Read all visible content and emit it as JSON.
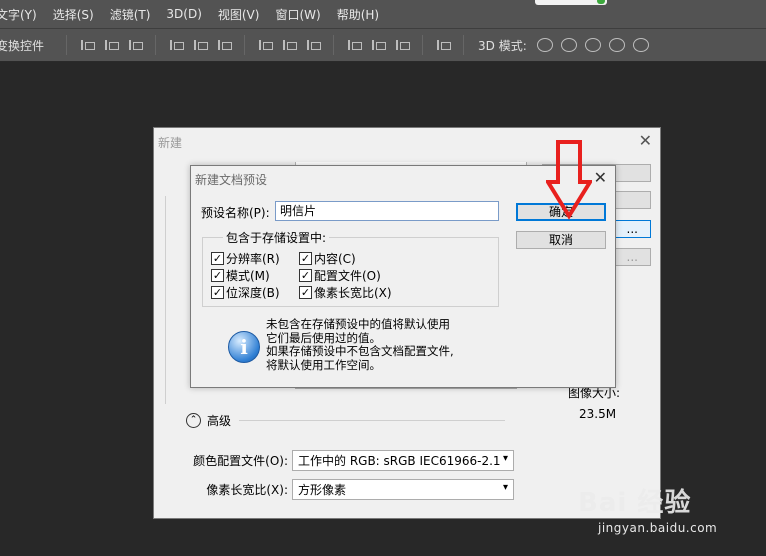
{
  "menubar": {
    "items": [
      "文字(Y)",
      "选择(S)",
      "滤镜(T)",
      "3D(D)",
      "视图(V)",
      "窗口(W)",
      "帮助(H)"
    ]
  },
  "optbar": {
    "transform_label": "变换控件",
    "mode3d_label": "3D 模式:"
  },
  "new_dialog": {
    "title": "新建",
    "close": "✕",
    "image_size_label": "图像大小:",
    "image_size_value": "23.5M",
    "advanced_label": "高级",
    "color_profile_label": "颜色配置文件(O):",
    "color_profile_value": "工作中的 RGB: sRGB IEC61966-2.1",
    "pixel_aspect_label": "像素长宽比(X):",
    "pixel_aspect_value": "方形像素",
    "ellipsis_1": "...",
    "ellipsis_2": "..."
  },
  "preset_dialog": {
    "title": "新建文档预设",
    "close": "✕",
    "name_label": "预设名称(P):",
    "name_value": "明信片",
    "group_legend": "包含于存储设置中:",
    "checkboxes": [
      {
        "label": "分辨率(R)",
        "checked": true
      },
      {
        "label": "内容(C)",
        "checked": true
      },
      {
        "label": "模式(M)",
        "checked": true
      },
      {
        "label": "配置文件(O)",
        "checked": true
      },
      {
        "label": "位深度(B)",
        "checked": true
      },
      {
        "label": "像素长宽比(X)",
        "checked": true
      }
    ],
    "ok_label": "确定",
    "cancel_label": "取消",
    "info_lines": [
      "未包含在存储预设中的值将默认使用",
      "它们最后使用过的值。",
      "如果存储预设中不包含文档配置文件,",
      "将默认使用工作空间。"
    ]
  },
  "watermark": {
    "logo": "Bai 经验",
    "url": "jingyan.baidu.com"
  },
  "colors": {
    "accent": "#0078d7",
    "annotation_arrow": "#e8201e"
  }
}
